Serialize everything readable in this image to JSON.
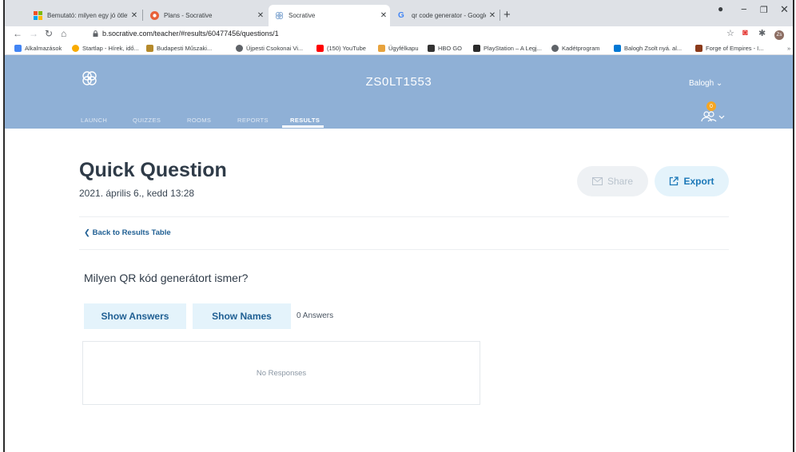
{
  "browser": {
    "tabs": [
      {
        "title": "Bemutató: milyen egy jó ötletbö",
        "active": false
      },
      {
        "title": "Plans - Socrative",
        "active": false
      },
      {
        "title": "Socrative",
        "active": true
      },
      {
        "title": "qr code generator - Google-kere",
        "active": false
      }
    ],
    "new_tab": "+",
    "controls": {
      "minimize": "−",
      "maximize": "❐",
      "close": "✕"
    },
    "url": "b.socrative.com/teacher/#results/60477456/questions/1",
    "profile_initials": "Zs",
    "bookmarks": [
      {
        "label": "Alkalmazások",
        "color": "#4285f4"
      },
      {
        "label": "Startlap - Hírek, idő...",
        "color": "#f9ab00"
      },
      {
        "label": "Budapesti Műszaki...",
        "color": "#b58a2b"
      },
      {
        "label": "Újpesti Csokonai Vi...",
        "color": "#5f6368"
      },
      {
        "label": "(150) YouTube",
        "color": "#ff0000"
      },
      {
        "label": "Ügyfélkapu",
        "color": "#e8a33d"
      },
      {
        "label": "HBO GO",
        "color": "#333333"
      },
      {
        "label": "PlayStation – A Legj...",
        "color": "#2b2b2b"
      },
      {
        "label": "Kadétprogram",
        "color": "#5f6368"
      },
      {
        "label": "Balogh Zsolt nyá. al...",
        "color": "#0078d4"
      },
      {
        "label": "Forge of Empires - I...",
        "color": "#8b3a1a"
      }
    ]
  },
  "app": {
    "room_name": "ZS0LT1553",
    "user_name": "Balogh",
    "student_count": "0",
    "nav": [
      "LAUNCH",
      "QUIZZES",
      "ROOMS",
      "REPORTS",
      "RESULTS"
    ]
  },
  "content": {
    "title": "Quick Question",
    "date": "2021. április 6., kedd 13:28",
    "share_label": "Share",
    "export_label": "Export",
    "back_label": "Back to Results Table",
    "question": "Milyen QR kód generátort ismer?",
    "show_answers_label": "Show Answers",
    "show_names_label": "Show Names",
    "answers_count": "0 Answers",
    "no_responses": "No Responses"
  },
  "colors": {
    "header_bg": "#8fb0d6",
    "accent_light": "#e4f3fb",
    "accent_text": "#1f5f93"
  }
}
